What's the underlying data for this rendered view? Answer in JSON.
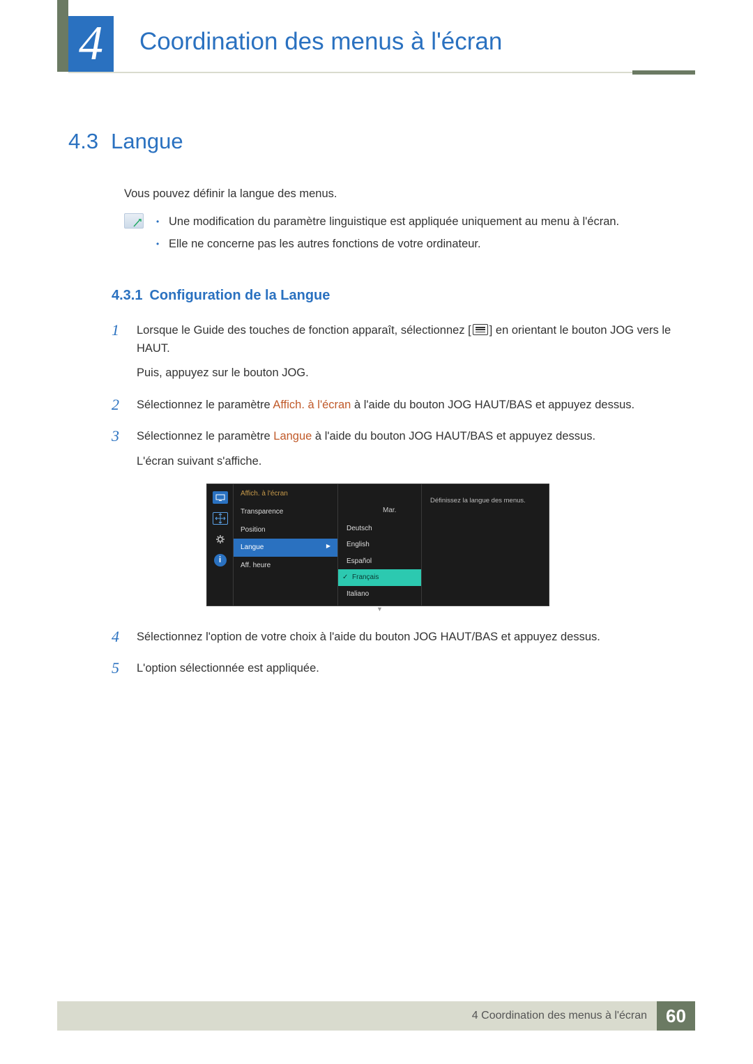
{
  "chapter": {
    "number": "4",
    "title": "Coordination des menus à l'écran"
  },
  "section": {
    "number": "4.3",
    "title": "Langue",
    "intro": "Vous pouvez définir la langue des menus.",
    "notes": [
      "Une modification du paramètre linguistique est appliquée uniquement au menu à l'écran.",
      "Elle ne concerne pas les autres fonctions de votre ordinateur."
    ]
  },
  "subsection": {
    "number": "4.3.1",
    "title": "Configuration de la Langue"
  },
  "steps": {
    "s1": {
      "num": "1",
      "text_a": "Lorsque le Guide des touches de fonction apparaît, sélectionnez [",
      "text_b": "] en orientant le bouton JOG vers le HAUT.",
      "text_c": "Puis, appuyez sur le bouton JOG."
    },
    "s2": {
      "num": "2",
      "text_a": "Sélectionnez le paramètre ",
      "accent": "Affich. à l'écran",
      "text_b": " à l'aide du bouton JOG HAUT/BAS et appuyez dessus."
    },
    "s3": {
      "num": "3",
      "text_a": "Sélectionnez le paramètre ",
      "accent": "Langue",
      "text_b": " à l'aide du bouton JOG HAUT/BAS et appuyez dessus.",
      "text_c": "L'écran suivant s'affiche."
    },
    "s4": {
      "num": "4",
      "text": "Sélectionnez l'option de votre choix à l'aide du bouton JOG HAUT/BAS et appuyez dessus."
    },
    "s5": {
      "num": "5",
      "text": "L'option sélectionnée est appliquée."
    }
  },
  "osd": {
    "header": "Affich. à l'écran",
    "items": {
      "transparency": "Transparence",
      "transparency_value": "Mar.",
      "position": "Position",
      "language": "Langue",
      "timer": "Aff. heure"
    },
    "languages": [
      "Deutsch",
      "English",
      "Español",
      "Français",
      "Italiano"
    ],
    "selected_language": "Français",
    "help": "Définissez la langue des menus."
  },
  "footer": {
    "label": "4 Coordination des menus à l'écran",
    "page": "60"
  }
}
